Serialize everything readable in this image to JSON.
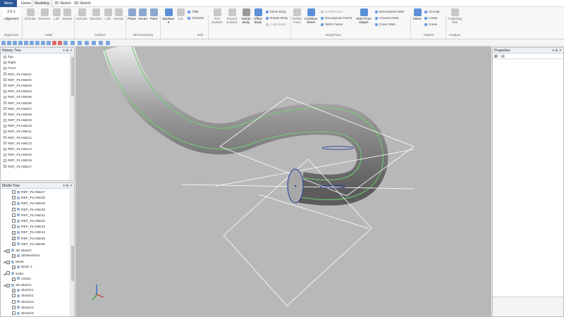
{
  "menu": {
    "label": "Menu"
  },
  "tabs": [
    {
      "label": "Home",
      "active": false
    },
    {
      "label": "Modeling",
      "active": true
    },
    {
      "label": "2D Sketch",
      "active": false
    },
    {
      "label": "3D Sketch",
      "active": false
    }
  ],
  "ribbon": {
    "alignment": {
      "top": "3-2-1",
      "bottom": "Alignment"
    },
    "solid": [
      "Extrude",
      "Revolve",
      "Loft",
      "Sweep"
    ],
    "surface": [
      "Extrude",
      "Revolve",
      "Loft",
      "Sweep"
    ],
    "ref_geometry": [
      "Plane",
      "Vector",
      "Point"
    ],
    "edit_big": [
      "Boolean",
      "Cut"
    ],
    "edit_small": [
      "Fillet",
      "Chamfer"
    ],
    "trim": [
      "Trim Surface",
      "Extend Surface",
      "Delete Body",
      "Offset Body"
    ],
    "move": [
      "Move Body",
      "Rotate Body",
      "Copy Body"
    ],
    "body_face_big": [
      "Delete Face",
      "Combine Sheet"
    ],
    "body_face_small": [
      "Unfold Face",
      "Decompose Faces",
      "Stitch Faces"
    ],
    "wire_from_edges": "Wire From Edges",
    "wire_ops": [
      "Decompose Wire",
      "Connect Wire",
      "Cover Wire"
    ],
    "pattern_big": "Mirror",
    "pattern_small": [
      "Circular",
      "Linear",
      "Curve"
    ],
    "analyzing": "Analyzing Tool",
    "groups": [
      "Alignment",
      "Solid",
      "Surface",
      "Ref Geometry",
      "Edit",
      "Body/Face",
      "Pattern",
      "Analyze"
    ]
  },
  "history_tree": {
    "title": "History Tree",
    "items": [
      "Top",
      "Right",
      "Front",
      "REF_PLANE01",
      "REF_PLANE02",
      "REF_PLANE03",
      "REF_PLANE04",
      "REF_PLANE05",
      "REF_PLANE06",
      "REF_PLANE07",
      "REF_PLANE08",
      "REF_PLANE09",
      "REF_PLANE10",
      "REF_PLANE11",
      "REF_PLANE12",
      "REF_PLANE13",
      "REF_PLANE14",
      "REF_PLANE15",
      "REF_PLANE16",
      "REF_PLANE17"
    ]
  },
  "model_tree": {
    "title": "Model Tree",
    "items": [
      {
        "label": "REF_PLANE27",
        "checked": false,
        "level": 1
      },
      {
        "label": "REF_PLANE28",
        "checked": false,
        "level": 1
      },
      {
        "label": "REF_PLANE29",
        "checked": false,
        "level": 1
      },
      {
        "label": "REF_PLANE30",
        "checked": false,
        "level": 1
      },
      {
        "label": "REF_PLANE31",
        "checked": false,
        "level": 1
      },
      {
        "label": "REF_PLANE32",
        "checked": false,
        "level": 1
      },
      {
        "label": "REF_PLANE33",
        "checked": false,
        "level": 1
      },
      {
        "label": "REF_PLANE34",
        "checked": true,
        "level": 1
      },
      {
        "label": "REF_PLANE35",
        "checked": true,
        "level": 1
      },
      {
        "label": "REF_PLANE36",
        "checked": true,
        "level": 1
      },
      {
        "label": "3D Sketch",
        "checked": true,
        "level": 0
      },
      {
        "label": "3DSketch01",
        "checked": true,
        "level": 1
      },
      {
        "label": "Mesh",
        "checked": true,
        "level": 0
      },
      {
        "label": "Mesh 1",
        "checked": true,
        "level": 1
      },
      {
        "label": "Solid",
        "checked": false,
        "level": 0
      },
      {
        "label": "Unite1",
        "checked": true,
        "level": 1
      },
      {
        "label": "2D Sketch",
        "checked": true,
        "level": 0
      },
      {
        "label": "Sketch1",
        "checked": true,
        "level": 1
      },
      {
        "label": "Sketch2",
        "checked": false,
        "level": 1
      },
      {
        "label": "Sketch3",
        "checked": false,
        "level": 1
      },
      {
        "label": "Sketch4",
        "checked": false,
        "level": 1
      },
      {
        "label": "Sketch5",
        "checked": false,
        "level": 1
      }
    ]
  },
  "properties": {
    "title": "Properties"
  },
  "colors": {
    "menu": "#2b5797",
    "viewport": "#b8b8b8",
    "body_edge": "#6fd06f",
    "circle": "#1f3a9a"
  }
}
